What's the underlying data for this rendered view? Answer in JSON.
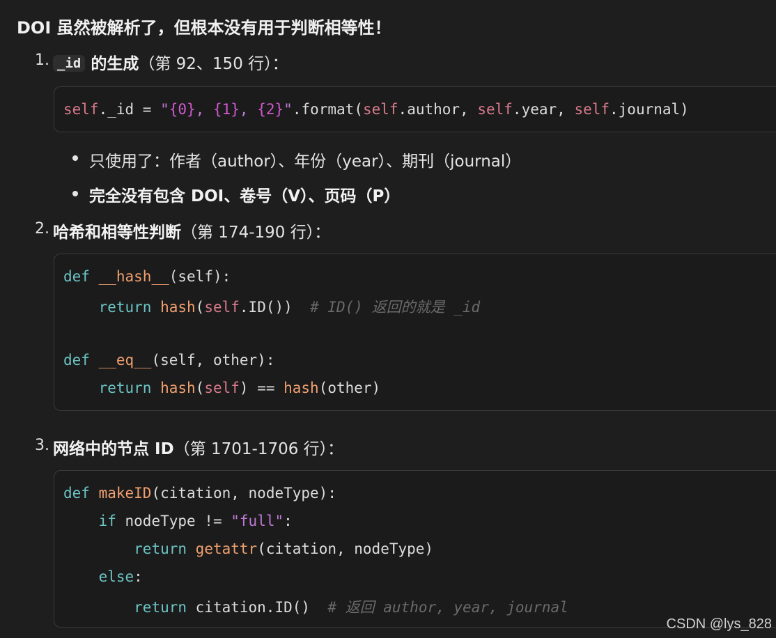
{
  "heading": "DOI 虽然被解析了，但根本没有用于判断相等性！",
  "items": [
    {
      "number": "1.",
      "code": "_id",
      "title": " 的生成",
      "suffix": "（第 92、150 行）："
    },
    {
      "number": "2.",
      "title": "哈希和相等性判断",
      "suffix": "（第 174-190 行）："
    },
    {
      "number": "3.",
      "title": "网络中的节点 ID",
      "suffix": "（第 1701-1706 行）："
    }
  ],
  "code1": {
    "self1": "self",
    "a": "._id = ",
    "q1": "\"",
    "f0": "{0}",
    "c1": ", ",
    "f1": "{1}",
    "c2": ", ",
    "f2": "{2}",
    "q2": "\"",
    "b": ".format(",
    "self2": "self",
    "c": ".author, ",
    "self3": "self",
    "d": ".year, ",
    "self4": "self",
    "e": ".journal)"
  },
  "bullets": [
    "只使用了：作者（author）、年份（year）、期刊（journal）",
    "完全没有包含 DOI、卷号（V）、页码（P）"
  ],
  "code2": {
    "l1_kw": "def",
    "l1_fn": "__hash__",
    "l1_rest": "(self):",
    "l2_kw": "return",
    "l2_fn": "hash",
    "l2_a": "(",
    "l2_self": "self",
    "l2_b": ".ID())",
    "l2_cmt": "# ID() 返回的就是 _id",
    "l4_kw": "def",
    "l4_fn": "__eq__",
    "l4_rest": "(self, other):",
    "l5_kw": "return",
    "l5_fn1": "hash",
    "l5_a": "(",
    "l5_self": "self",
    "l5_b": ") == ",
    "l5_fn2": "hash",
    "l5_c": "(other)"
  },
  "code3": {
    "l1_kw": "def",
    "l1_fn": "makeID",
    "l1_rest": "(citation, nodeType):",
    "l2_kw": "if",
    "l2_a": " nodeType != ",
    "l2_q1": "\"",
    "l2_str": "full",
    "l2_q2": "\"",
    "l2_b": ":",
    "l3_kw": "return",
    "l3_fn": "getattr",
    "l3_rest": "(citation, nodeType)",
    "l4_kw": "else",
    "l4_rest": ":",
    "l5_kw": "return",
    "l5_rest": " citation.ID()",
    "l5_cmt": "# 返回 author, year, journal"
  },
  "watermark": "CSDN @lys_828"
}
